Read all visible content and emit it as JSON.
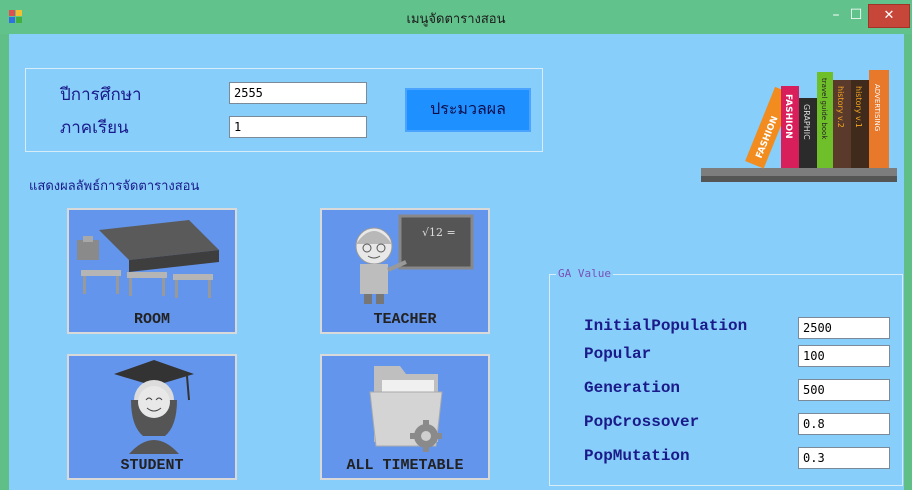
{
  "window": {
    "title": "เมนูจัดตารางสอน",
    "minimize": "–",
    "maximize": "☐",
    "close": "✕"
  },
  "form": {
    "year_label": "ปีการศึกษา",
    "year_value": "2555",
    "semester_label": "ภาคเรียน",
    "semester_value": "1",
    "process_label": "ประมวลผล"
  },
  "results_label": "แสดงผลลัพธ์การจัดตารางสอน",
  "tiles": {
    "room": "ROOM",
    "teacher": "TEACHER",
    "student": "STUDENT",
    "all_timetable": "ALL TIMETABLE"
  },
  "ga": {
    "legend": "GA Value",
    "initial_population_label": "InitialPopulation",
    "initial_population_value": "2500",
    "popular_label": "Popular",
    "popular_value": "100",
    "generation_label": "Generation",
    "generation_value": "500",
    "pop_crossover_label": "PopCrossover",
    "pop_crossover_value": "0.8",
    "pop_mutation_label": "PopMutation",
    "pop_mutation_value": "0.3"
  },
  "books": [
    "FASHION",
    "FASHION",
    "GRAPHIC",
    "travel guide book",
    "history v.2",
    "history v.1",
    "ADVERTISING"
  ],
  "colors": {
    "accent": "#1e90ff",
    "background": "#87cefa",
    "titlebar": "#62c28b",
    "tile": "#6495ed"
  }
}
